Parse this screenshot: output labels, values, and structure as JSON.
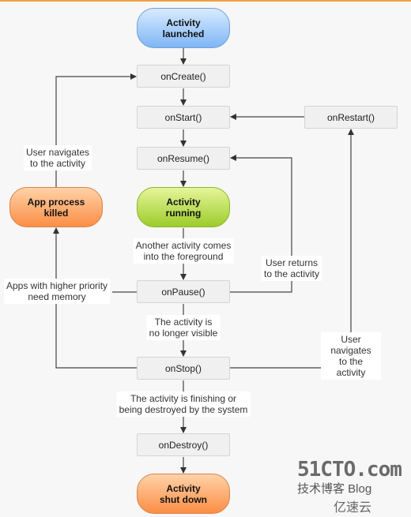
{
  "nodes": {
    "launched": "Activity\nlaunched",
    "on_create": "onCreate()",
    "on_start": "onStart()",
    "on_restart": "onRestart()",
    "on_resume": "onResume()",
    "running": "Activity\nrunning",
    "killed": "App process\nkilled",
    "on_pause": "onPause()",
    "on_stop": "onStop()",
    "on_destroy": "onDestroy()",
    "shut_down": "Activity\nshut down"
  },
  "labels": {
    "user_navigates_left": "User navigates\nto the activity",
    "another_activity": "Another activity comes\ninto the foreground",
    "user_returns": "User returns\nto the activity",
    "higher_priority": "Apps with higher priority\nneed memory",
    "no_longer_visible": "The activity is\nno longer visible",
    "user_navigates_right": "User navigates\nto the activity",
    "finishing": "The activity is finishing or\nbeing destroyed by the system"
  },
  "watermark": {
    "line1": "51CTO.com",
    "line2": "技术博客  Blog",
    "line3": "亿速云"
  },
  "colors": {
    "start": "#7fb6f5",
    "running": "#9ccc2a",
    "end": "#fb8e45",
    "accent_bar": "#f0a040"
  }
}
